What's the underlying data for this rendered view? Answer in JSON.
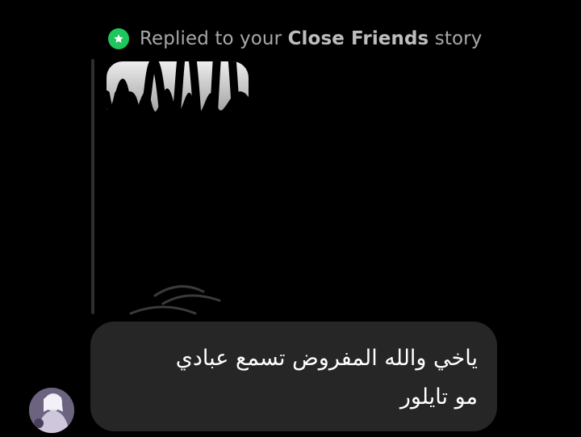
{
  "reply_header": {
    "prefix": "Replied to your",
    "story_type": "Close Friends",
    "suffix": "story",
    "badge_color": "#1fc55d"
  },
  "message": {
    "line1": "ياخي والله المفروض تسمع عبادي",
    "line2": "مو تايلور"
  },
  "colors": {
    "background": "#000000",
    "bubble": "#262626",
    "header_text": "#a8a8a8"
  }
}
